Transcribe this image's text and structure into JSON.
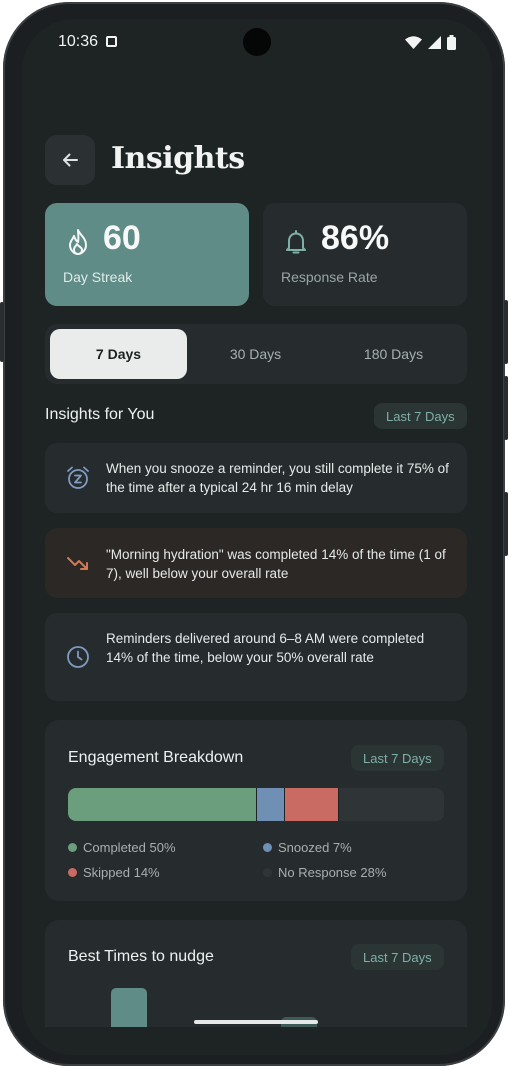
{
  "status": {
    "time": "10:36"
  },
  "header": {
    "title": "Insights"
  },
  "stats": {
    "streak": {
      "value": "60",
      "label": "Day Streak"
    },
    "rate": {
      "value": "86%",
      "label": "Response Rate"
    }
  },
  "tabs": [
    {
      "label": "7 Days",
      "active": true
    },
    {
      "label": "30 Days",
      "active": false
    },
    {
      "label": "180 Days",
      "active": false
    }
  ],
  "insights_section": {
    "title": "Insights for You",
    "range": "Last 7 Days"
  },
  "insights": [
    {
      "icon": "snooze-alarm-icon",
      "text": "When you snooze a reminder, you still complete it 75% of the time after a typical 24 hr 16 min delay"
    },
    {
      "icon": "trend-down-icon",
      "text": "\"Morning hydration\" was completed 14% of the time (1 of 7), well below your overall rate"
    },
    {
      "icon": "clock-icon",
      "text": "Reminders delivered around 6–8 AM were completed 14% of the time, below your 50% overall rate"
    }
  ],
  "engagement": {
    "title": "Engagement Breakdown",
    "range": "Last 7 Days",
    "segments": [
      {
        "key": "completed",
        "label": "Completed 50%",
        "value": 50,
        "color": "#6a9e7c"
      },
      {
        "key": "snoozed",
        "label": "Snoozed 7%",
        "value": 7,
        "color": "#6f8fb5"
      },
      {
        "key": "skipped",
        "label": "Skipped 14%",
        "value": 14,
        "color": "#c96b62"
      },
      {
        "key": "no_response",
        "label": "No Response 28%",
        "value": 28,
        "color": "#2f3537"
      }
    ]
  },
  "best_times": {
    "title": "Best Times to nudge",
    "range": "Last 7 Days"
  },
  "colors": {
    "accent": "#5f8c87",
    "card": "#262c2e",
    "background": "#1e2324"
  }
}
